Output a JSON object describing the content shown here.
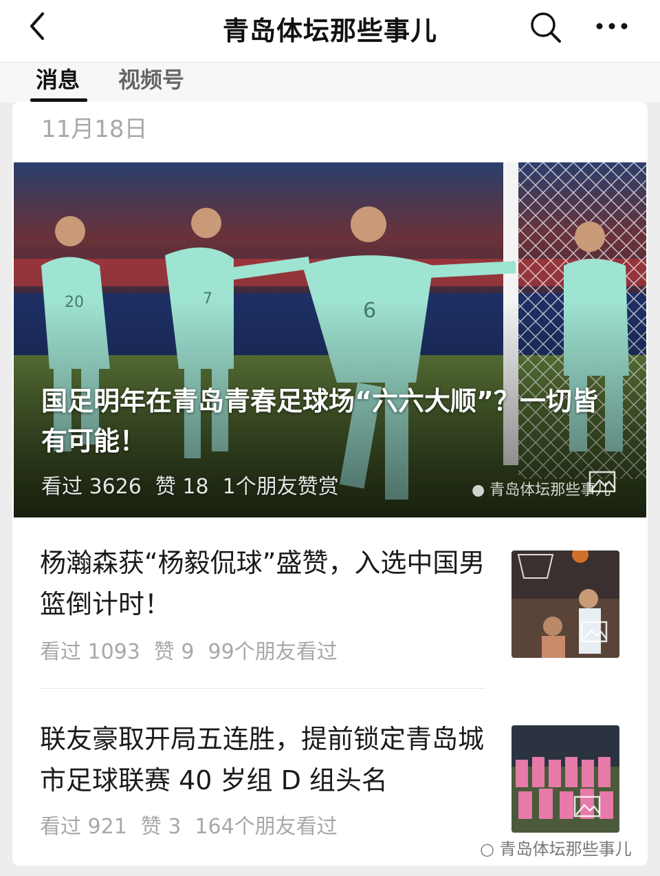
{
  "header": {
    "title": "青岛体坛那些事儿",
    "back_icon": "chevron-left-icon",
    "search_icon": "search-icon",
    "more_icon": "more-dots-icon"
  },
  "tabs": [
    {
      "label": "消息",
      "active": true
    },
    {
      "label": "视频号",
      "active": false
    }
  ],
  "date": "11月18日",
  "hero": {
    "title": "国足明年在青岛青春足球场“六六大顺”？一切皆有可能！",
    "views": "看过 3626",
    "likes": "赞 18",
    "friends": "1个朋友赞赏",
    "watermark": "青岛体坛那些事儿",
    "jersey_numbers": [
      "20",
      "7",
      "6"
    ]
  },
  "articles": [
    {
      "title": "杨瀚森获“杨毅侃球”盛赞，入选中国男篮倒计时！",
      "views": "看过 1093",
      "likes": "赞 9",
      "friends": "99个朋友看过"
    },
    {
      "title": "联友豪取开局五连胜，提前锁定青岛城市足球联赛 40 岁组 D 组头名",
      "views": "看过 921",
      "likes": "赞 3",
      "friends": "164个朋友看过"
    }
  ],
  "footer_watermark": "青岛体坛那些事儿",
  "colors": {
    "background": "#ededed",
    "card": "#ffffff",
    "muted_text": "#a8a8a8",
    "jersey": "#9fe3d2"
  }
}
